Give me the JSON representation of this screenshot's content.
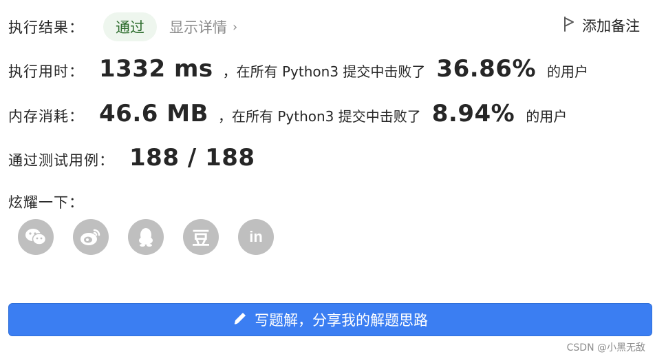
{
  "result": {
    "label": "执行结果：",
    "status": "通过",
    "details": "显示详情",
    "add_note": "添加备注"
  },
  "runtime": {
    "label": "执行用时：",
    "value": "1332 ms",
    "prefix": "，在所有 Python3 提交中击败了",
    "percent": "36.86%",
    "suffix": "的用户"
  },
  "memory": {
    "label": "内存消耗：",
    "value": "46.6 MB",
    "prefix": "，在所有 Python3 提交中击败了",
    "percent": "8.94%",
    "suffix": "的用户"
  },
  "tests": {
    "label": "通过测试用例：",
    "value": "188 / 188"
  },
  "share": {
    "label": "炫耀一下：",
    "icons": [
      "wechat-icon",
      "weibo-icon",
      "qq-icon",
      "douban-icon",
      "linkedin-icon"
    ],
    "douban_glyph": "豆",
    "linkedin_glyph": "in"
  },
  "write_solution": {
    "label": "写题解，分享我的解题思路"
  },
  "watermark": "CSDN @小黑无敌",
  "colors": {
    "accent": "#3b7ef2",
    "status_bg": "#eef6ee",
    "status_fg": "#2b6b2b",
    "icon_bg": "#bfbfbf"
  }
}
